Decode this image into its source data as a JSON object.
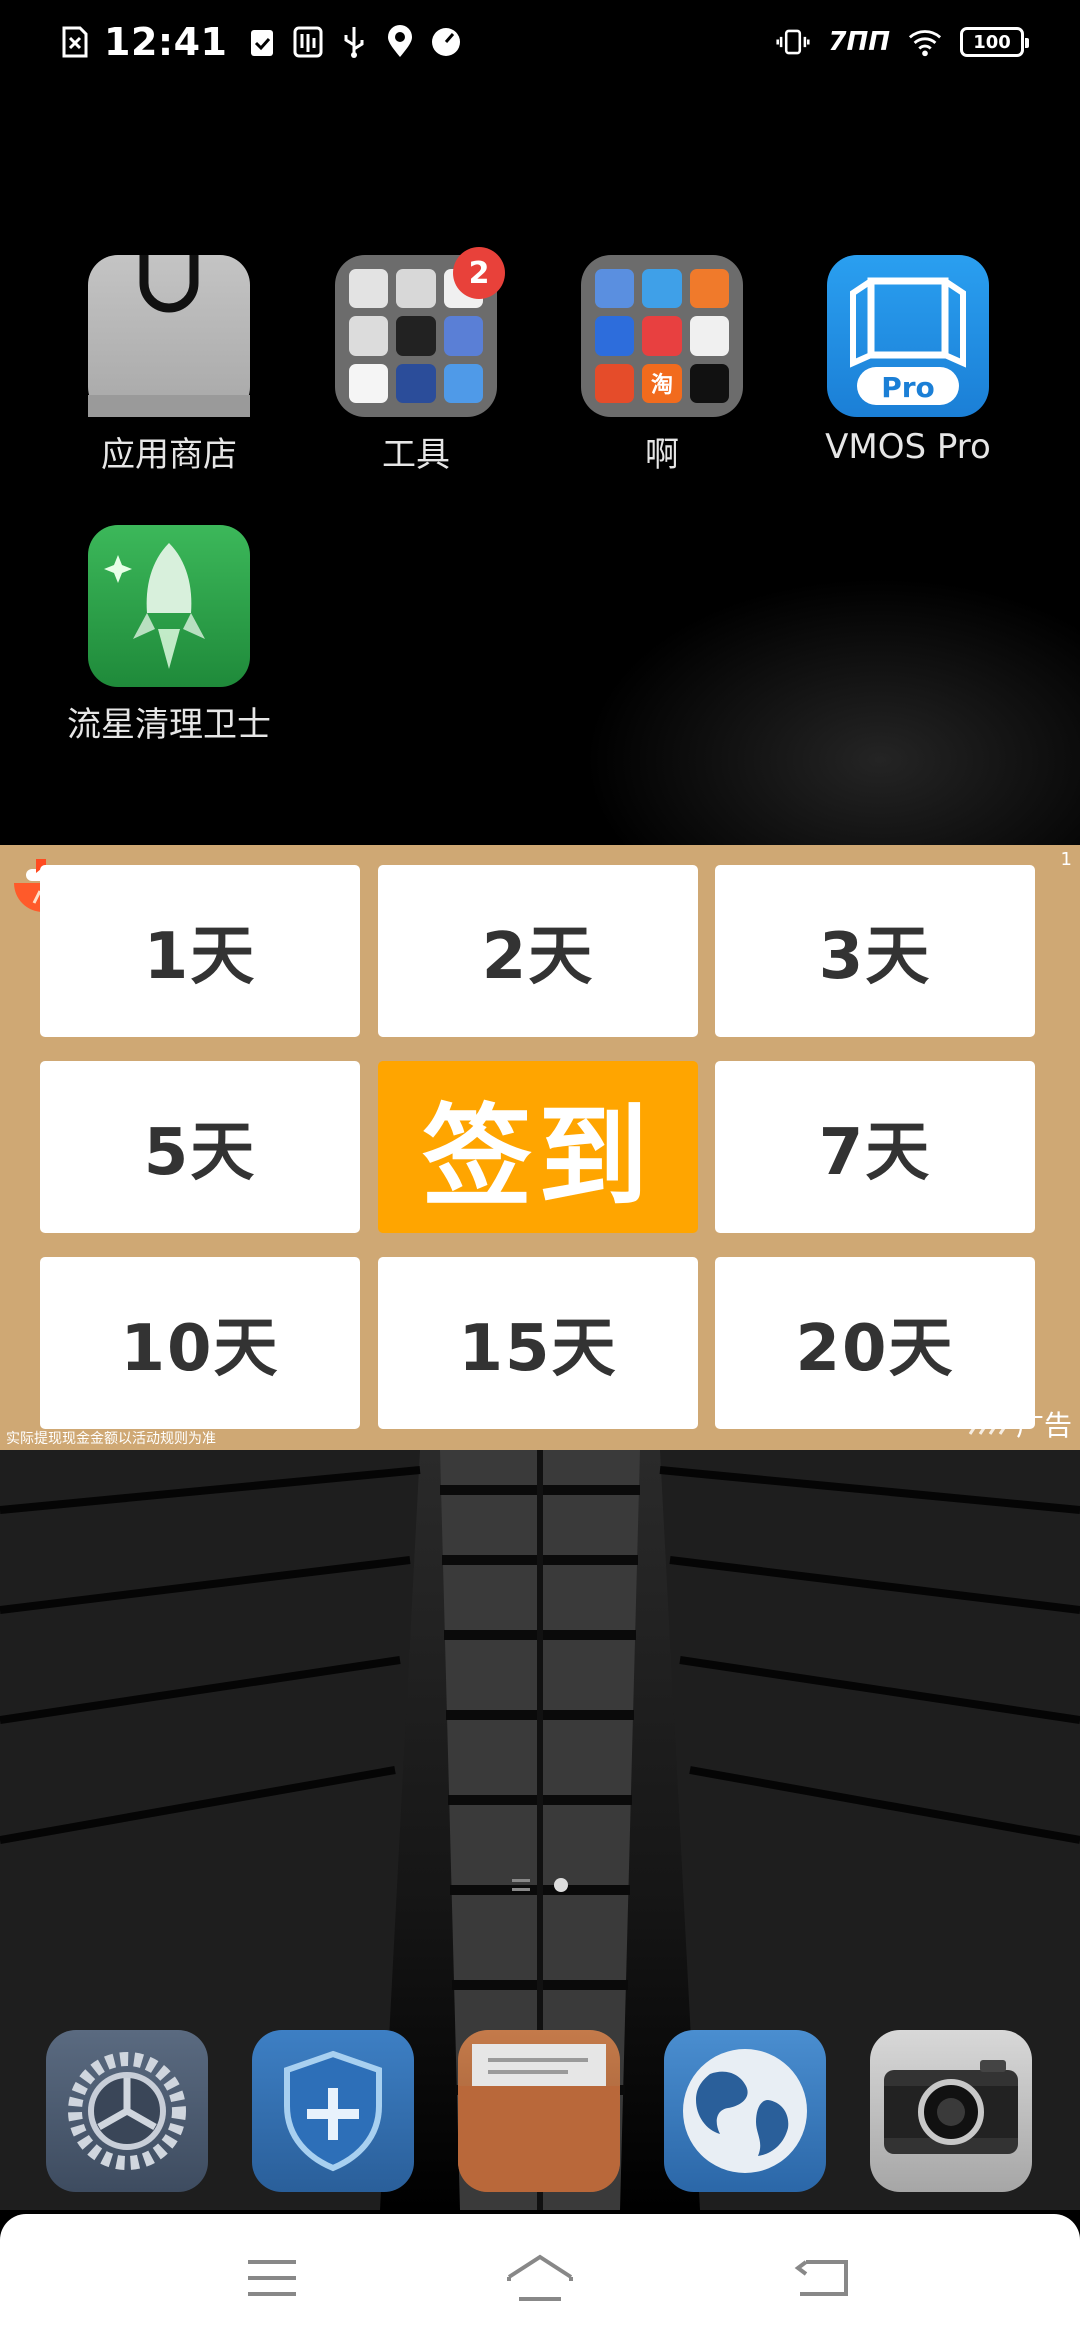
{
  "status_bar": {
    "time": "12:41",
    "network_label": "7ΠΠ",
    "battery": "100",
    "left_icons": [
      "notification-x-icon",
      "clipboard-check-icon",
      "usb-debug-icon",
      "usb-icon",
      "du-location-icon",
      "speedometer-icon"
    ],
    "right_icons": [
      "vibrate-icon",
      "network-icon",
      "wifi-icon",
      "battery-icon"
    ]
  },
  "apps": [
    {
      "label": "应用商店",
      "icon": "shopping-bag-icon"
    },
    {
      "label": "工具",
      "icon": "tools-folder-icon",
      "badge": "2"
    },
    {
      "label": "啊",
      "icon": "apps-folder-icon"
    },
    {
      "label": "VMOS Pro",
      "icon": "vmos-pro-icon",
      "icon_text": "Pro"
    },
    {
      "label": "流星清理卫士",
      "icon": "rocket-cleaner-icon"
    }
  ],
  "folder_apps": {
    "label_taobao": "淘"
  },
  "ad": {
    "cells": [
      "1天",
      "2天",
      "3天",
      "5天",
      "签到",
      "7天",
      "10天",
      "15天",
      "20天"
    ],
    "counter": "1",
    "disclaimer": "实际提现现金金额以活动规则为准",
    "ad_label": "广告",
    "colors": {
      "background": "#cfa874",
      "checkin": "#ffa500"
    }
  },
  "dock": [
    {
      "icon": "settings-gear-icon"
    },
    {
      "icon": "security-shield-icon"
    },
    {
      "icon": "file-manager-folder-icon"
    },
    {
      "icon": "browser-globe-icon"
    },
    {
      "icon": "camera-icon"
    }
  ],
  "nav": {
    "buttons": [
      "menu-icon",
      "home-icon",
      "back-icon"
    ]
  }
}
